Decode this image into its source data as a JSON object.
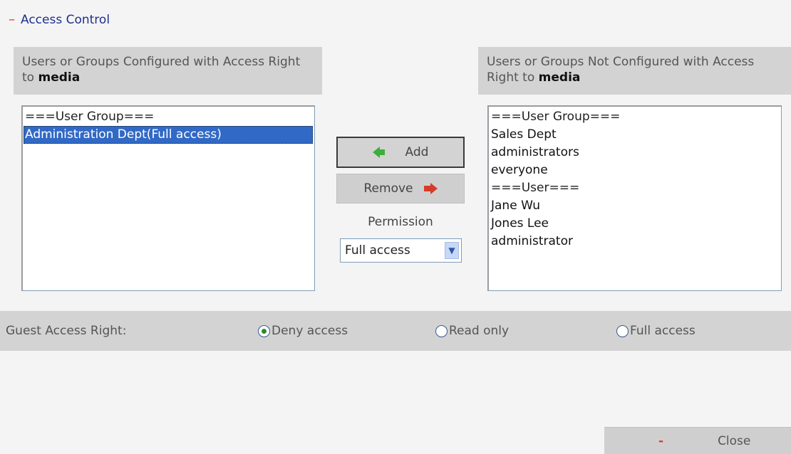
{
  "section": {
    "toggle": "–",
    "title": "Access Control"
  },
  "left_panel": {
    "header_prefix": "Users or Groups Configured with Access Right to",
    "header_share": "media",
    "items": [
      {
        "label": "===User Group===",
        "selected": false
      },
      {
        "label": "Administration Dept(Full access)",
        "selected": true
      }
    ]
  },
  "right_panel": {
    "header_prefix": "Users or Groups Not Configured with Access Right to",
    "header_share": "media",
    "items": [
      "===User Group===",
      "Sales Dept",
      "administrators",
      "everyone",
      "===User===",
      "Jane Wu",
      "Jones Lee",
      "administrator"
    ]
  },
  "actions": {
    "add_label": "Add",
    "remove_label": "Remove",
    "permission_label": "Permission",
    "permission_value": "Full access"
  },
  "guest": {
    "label": "Guest Access Right:",
    "options": [
      {
        "label": "Deny access",
        "checked": true
      },
      {
        "label": "Read only",
        "checked": false
      },
      {
        "label": "Full access",
        "checked": false
      }
    ]
  },
  "footer": {
    "close_label": "Close"
  },
  "colors": {
    "selection": "#3169c6",
    "panel_gray": "#d3d3d3",
    "title_blue": "#1f2f8f",
    "accent_red": "#e03a2e",
    "accent_green": "#3dae3d"
  }
}
